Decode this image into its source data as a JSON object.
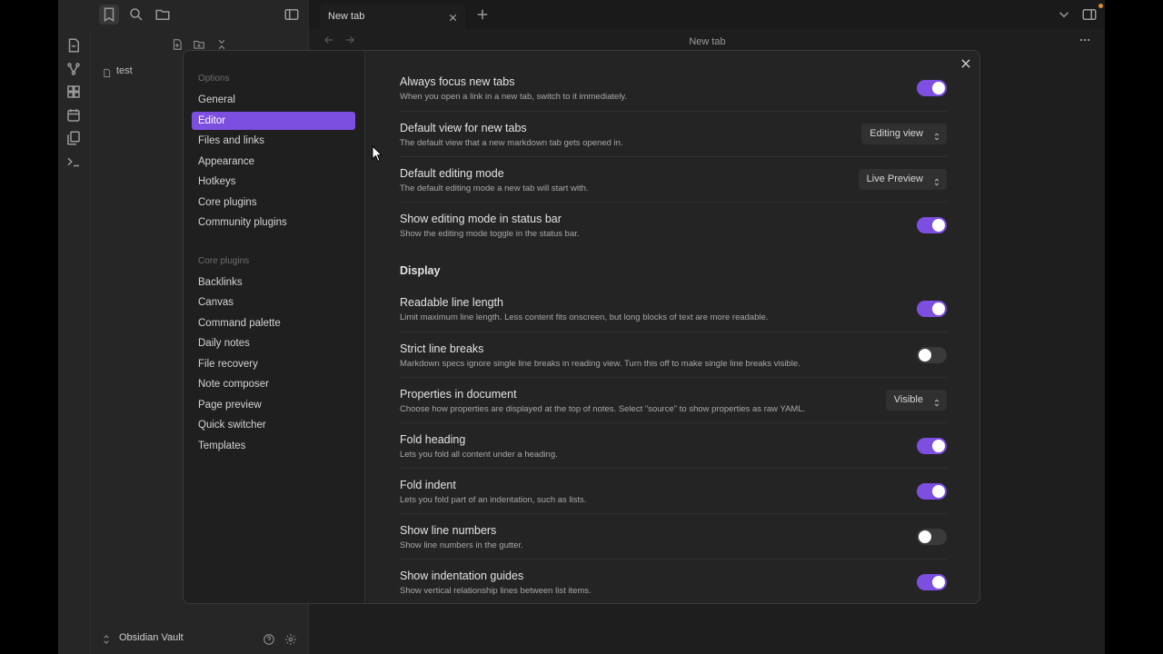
{
  "tabs": [
    {
      "title": "New tab"
    }
  ],
  "view": {
    "title": "New tab"
  },
  "file_tree": {
    "files": [
      "test"
    ]
  },
  "vault": {
    "name": "Obsidian Vault"
  },
  "settings": {
    "nav_groups": [
      {
        "title": "Options",
        "items": [
          "General",
          "Editor",
          "Files and links",
          "Appearance",
          "Hotkeys",
          "Core plugins",
          "Community plugins"
        ]
      },
      {
        "title": "Core plugins",
        "items": [
          "Backlinks",
          "Canvas",
          "Command palette",
          "Daily notes",
          "File recovery",
          "Note composer",
          "Page preview",
          "Quick switcher",
          "Templates"
        ]
      }
    ],
    "active_item": "Editor",
    "rows": [
      {
        "name": "Always focus new tabs",
        "desc": "When you open a link in a new tab, switch to it immediately.",
        "control": "toggle",
        "on": true
      },
      {
        "name": "Default view for new tabs",
        "desc": "The default view that a new markdown tab gets opened in.",
        "control": "dropdown",
        "value": "Editing view"
      },
      {
        "name": "Default editing mode",
        "desc": "The default editing mode a new tab will start with.",
        "control": "dropdown",
        "value": "Live Preview"
      },
      {
        "name": "Show editing mode in status bar",
        "desc": "Show the editing mode toggle in the status bar.",
        "control": "toggle",
        "on": true
      },
      {
        "heading": "Display"
      },
      {
        "name": "Readable line length",
        "desc": "Limit maximum line length. Less content fits onscreen, but long blocks of text are more readable.",
        "control": "toggle",
        "on": true
      },
      {
        "name": "Strict line breaks",
        "desc": "Markdown specs ignore single line breaks in reading view. Turn this off to make single line breaks visible.",
        "control": "toggle",
        "on": false
      },
      {
        "name": "Properties in document",
        "desc": "Choose how properties are displayed at the top of notes. Select \"source\" to show properties as raw YAML.",
        "control": "dropdown",
        "value": "Visible"
      },
      {
        "name": "Fold heading",
        "desc": "Lets you fold all content under a heading.",
        "control": "toggle",
        "on": true
      },
      {
        "name": "Fold indent",
        "desc": "Lets you fold part of an indentation, such as lists.",
        "control": "toggle",
        "on": true
      },
      {
        "name": "Show line numbers",
        "desc": "Show line numbers in the gutter.",
        "control": "toggle",
        "on": false
      },
      {
        "name": "Show indentation guides",
        "desc": "Show vertical relationship lines between list items.",
        "control": "toggle",
        "on": true
      }
    ]
  },
  "colors": {
    "accent": "#7d4fe0",
    "background": "#1e1e1e",
    "modal": "#242424"
  }
}
